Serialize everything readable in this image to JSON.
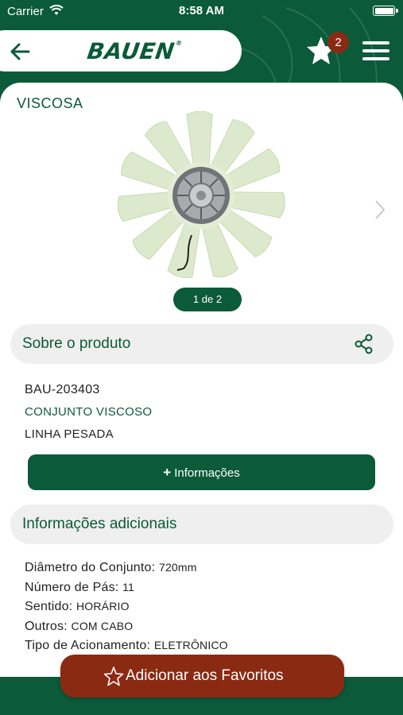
{
  "status": {
    "carrier": "Carrier",
    "time": "8:58 AM"
  },
  "header": {
    "brand": "BAUEN",
    "brand_mark": "®",
    "favorites_count": "2"
  },
  "product": {
    "category": "VISCOSA",
    "pager": "1 de 2",
    "code": "BAU-203403",
    "name": "CONJUNTO VISCOSO",
    "line": "LINHA PESADA"
  },
  "sections": {
    "about": "Sobre o produto",
    "more_info_button": "Informações",
    "additional": "Informações adicionais"
  },
  "specs": [
    {
      "label": "Diâmetro do Conjunto:",
      "value": "720mm"
    },
    {
      "label": "Número de Pás:",
      "value": "11"
    },
    {
      "label": "Sentido:",
      "value": "HORÁRIO"
    },
    {
      "label": "Outros:",
      "value": "COM CABO"
    },
    {
      "label": "Tipo de Acionamento:",
      "value": "ELETRÔNICO"
    }
  ],
  "actions": {
    "add_favorites": "Adicionar aos Favoritos"
  },
  "colors": {
    "primary_green": "#0b5a3a",
    "accent_brown": "#8b2a12",
    "blade": "#dfe9cf"
  },
  "icons": [
    "back-arrow-icon",
    "star-icon",
    "hamburger-menu-icon",
    "chevron-right-icon",
    "share-icon",
    "plus-icon",
    "star-outline-icon",
    "wifi-icon",
    "battery-icon"
  ]
}
